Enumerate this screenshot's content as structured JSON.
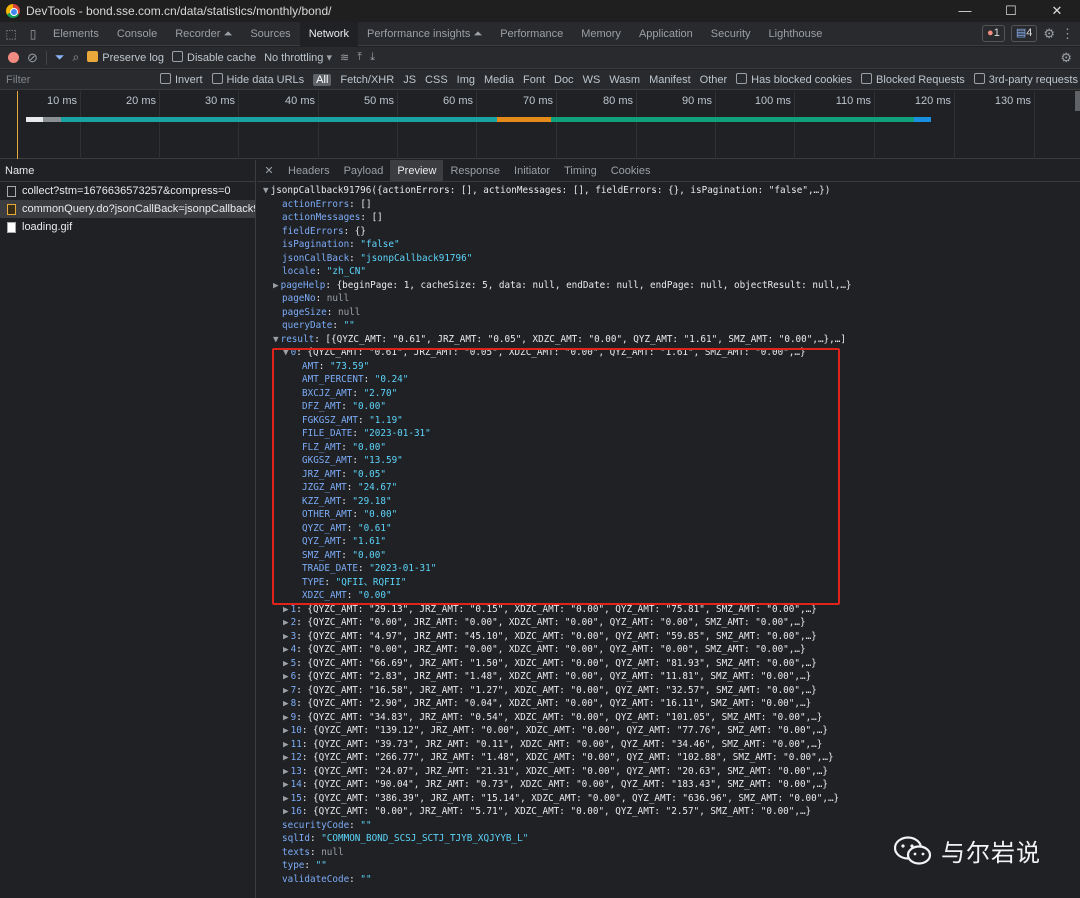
{
  "window": {
    "title": "DevTools - bond.sse.com.cn/data/statistics/monthly/bond/",
    "controls": [
      "—",
      "☐",
      "✕"
    ]
  },
  "devtools_tabs": [
    "Elements",
    "Console",
    "Recorder ⏶",
    "Sources",
    "Network",
    "Performance insights ⏶",
    "Performance",
    "Memory",
    "Application",
    "Security",
    "Lighthouse"
  ],
  "active_tab": "Network",
  "badges": {
    "errors": "1",
    "messages": "4"
  },
  "toolbar": {
    "preserve_log": "Preserve log",
    "disable_cache": "Disable cache",
    "throttling": "No throttling"
  },
  "filter": {
    "placeholder": "Filter",
    "invert": "Invert",
    "hide_data_urls": "Hide data URLs",
    "types": [
      "All",
      "Fetch/XHR",
      "JS",
      "CSS",
      "Img",
      "Media",
      "Font",
      "Doc",
      "WS",
      "Wasm",
      "Manifest",
      "Other"
    ],
    "blocked_cookies": "Has blocked cookies",
    "blocked_requests": "Blocked Requests",
    "third_party": "3rd-party requests"
  },
  "timeline_ticks": [
    "10 ms",
    "20 ms",
    "30 ms",
    "40 ms",
    "50 ms",
    "60 ms",
    "70 ms",
    "80 ms",
    "90 ms",
    "100 ms",
    "110 ms",
    "120 ms",
    "130 ms"
  ],
  "requests": {
    "header": "Name",
    "items": [
      {
        "name": "collect?stm=1676636573257&compress=0",
        "kind": "doc"
      },
      {
        "name": "commonQuery.do?jsonCallBack=jsonpCallback91…",
        "kind": "js"
      },
      {
        "name": "loading.gif",
        "kind": "img"
      }
    ]
  },
  "detail_tabs": [
    "Headers",
    "Payload",
    "Preview",
    "Response",
    "Initiator",
    "Timing",
    "Cookies"
  ],
  "active_detail_tab": "Preview",
  "preview_lines": [
    {
      "i": 0,
      "a": "▼",
      "t": [
        [
          "p",
          "jsonpCallback91796({actionErrors: [], actionMessages: [], fieldErrors: {}, isPagination: \"false\",…})"
        ]
      ]
    },
    {
      "i": 1,
      "t": [
        [
          "k",
          "actionErrors"
        ],
        [
          "p",
          ": []"
        ]
      ]
    },
    {
      "i": 1,
      "t": [
        [
          "k",
          "actionMessages"
        ],
        [
          "p",
          ": []"
        ]
      ]
    },
    {
      "i": 1,
      "t": [
        [
          "k",
          "fieldErrors"
        ],
        [
          "p",
          ": {}"
        ]
      ]
    },
    {
      "i": 1,
      "t": [
        [
          "k",
          "isPagination"
        ],
        [
          "p",
          ": "
        ],
        [
          "s",
          "\"false\""
        ]
      ]
    },
    {
      "i": 1,
      "t": [
        [
          "k",
          "jsonCallBack"
        ],
        [
          "p",
          ": "
        ],
        [
          "s",
          "\"jsonpCallback91796\""
        ]
      ]
    },
    {
      "i": 1,
      "t": [
        [
          "k",
          "locale"
        ],
        [
          "p",
          ": "
        ],
        [
          "s",
          "\"zh_CN\""
        ]
      ]
    },
    {
      "i": 1,
      "a": "▶",
      "t": [
        [
          "k",
          "pageHelp"
        ],
        [
          "p",
          ": {beginPage: 1, cacheSize: 5, data: null, endDate: null, endPage: null, objectResult: null,…}"
        ]
      ]
    },
    {
      "i": 1,
      "t": [
        [
          "k",
          "pageNo"
        ],
        [
          "p",
          ": "
        ],
        [
          "n",
          "null"
        ]
      ]
    },
    {
      "i": 1,
      "t": [
        [
          "k",
          "pageSize"
        ],
        [
          "p",
          ": "
        ],
        [
          "n",
          "null"
        ]
      ]
    },
    {
      "i": 1,
      "t": [
        [
          "k",
          "queryDate"
        ],
        [
          "p",
          ": "
        ],
        [
          "s",
          "\"\""
        ]
      ]
    },
    {
      "i": 1,
      "a": "▼",
      "t": [
        [
          "k",
          "result"
        ],
        [
          "p",
          ": [{QYZC_AMT: \"0.61\", JRZ_AMT: \"0.05\", XDZC_AMT: \"0.00\", QYZ_AMT: \"1.61\", SMZ_AMT: \"0.00\",…},…]"
        ]
      ]
    },
    {
      "i": 2,
      "a": "▼",
      "t": [
        [
          "k",
          "0"
        ],
        [
          "p",
          ": {QYZC_AMT: \"0.61\", JRZ_AMT: \"0.05\", XDZC_AMT: \"0.00\", QYZ_AMT: \"1.61\", SMZ_AMT: \"0.00\",…}"
        ]
      ]
    },
    {
      "i": 3,
      "t": [
        [
          "k",
          "AMT"
        ],
        [
          "p",
          ": "
        ],
        [
          "s",
          "\"73.59\""
        ]
      ]
    },
    {
      "i": 3,
      "t": [
        [
          "k",
          "AMT_PERCENT"
        ],
        [
          "p",
          ": "
        ],
        [
          "s",
          "\"0.24\""
        ]
      ]
    },
    {
      "i": 3,
      "t": [
        [
          "k",
          "BXCJZ_AMT"
        ],
        [
          "p",
          ": "
        ],
        [
          "s",
          "\"2.70\""
        ]
      ]
    },
    {
      "i": 3,
      "t": [
        [
          "k",
          "DFZ_AMT"
        ],
        [
          "p",
          ": "
        ],
        [
          "s",
          "\"0.00\""
        ]
      ]
    },
    {
      "i": 3,
      "t": [
        [
          "k",
          "FGKGSZ_AMT"
        ],
        [
          "p",
          ": "
        ],
        [
          "s",
          "\"1.19\""
        ]
      ]
    },
    {
      "i": 3,
      "t": [
        [
          "k",
          "FILE_DATE"
        ],
        [
          "p",
          ": "
        ],
        [
          "s",
          "\"2023-01-31\""
        ]
      ]
    },
    {
      "i": 3,
      "t": [
        [
          "k",
          "FLZ_AMT"
        ],
        [
          "p",
          ": "
        ],
        [
          "s",
          "\"0.00\""
        ]
      ]
    },
    {
      "i": 3,
      "t": [
        [
          "k",
          "GKGSZ_AMT"
        ],
        [
          "p",
          ": "
        ],
        [
          "s",
          "\"13.59\""
        ]
      ]
    },
    {
      "i": 3,
      "t": [
        [
          "k",
          "JRZ_AMT"
        ],
        [
          "p",
          ": "
        ],
        [
          "s",
          "\"0.05\""
        ]
      ]
    },
    {
      "i": 3,
      "t": [
        [
          "k",
          "JZGZ_AMT"
        ],
        [
          "p",
          ": "
        ],
        [
          "s",
          "\"24.67\""
        ]
      ]
    },
    {
      "i": 3,
      "t": [
        [
          "k",
          "KZZ_AMT"
        ],
        [
          "p",
          ": "
        ],
        [
          "s",
          "\"29.18\""
        ]
      ]
    },
    {
      "i": 3,
      "t": [
        [
          "k",
          "OTHER_AMT"
        ],
        [
          "p",
          ": "
        ],
        [
          "s",
          "\"0.00\""
        ]
      ]
    },
    {
      "i": 3,
      "t": [
        [
          "k",
          "QYZC_AMT"
        ],
        [
          "p",
          ": "
        ],
        [
          "s",
          "\"0.61\""
        ]
      ]
    },
    {
      "i": 3,
      "t": [
        [
          "k",
          "QYZ_AMT"
        ],
        [
          "p",
          ": "
        ],
        [
          "s",
          "\"1.61\""
        ]
      ]
    },
    {
      "i": 3,
      "t": [
        [
          "k",
          "SMZ_AMT"
        ],
        [
          "p",
          ": "
        ],
        [
          "s",
          "\"0.00\""
        ]
      ]
    },
    {
      "i": 3,
      "t": [
        [
          "k",
          "TRADE_DATE"
        ],
        [
          "p",
          ": "
        ],
        [
          "s",
          "\"2023-01-31\""
        ]
      ]
    },
    {
      "i": 3,
      "t": [
        [
          "k",
          "TYPE"
        ],
        [
          "p",
          ": "
        ],
        [
          "s",
          "\"QFII、RQFII\""
        ]
      ]
    },
    {
      "i": 3,
      "t": [
        [
          "k",
          "XDZC_AMT"
        ],
        [
          "p",
          ": "
        ],
        [
          "s",
          "\"0.00\""
        ]
      ]
    },
    {
      "i": 2,
      "a": "▶",
      "t": [
        [
          "k",
          "1"
        ],
        [
          "p",
          ": {QYZC_AMT: \"29.13\", JRZ_AMT: \"0.15\", XDZC_AMT: \"0.00\", QYZ_AMT: \"75.81\", SMZ_AMT: \"0.00\",…}"
        ]
      ]
    },
    {
      "i": 2,
      "a": "▶",
      "t": [
        [
          "k",
          "2"
        ],
        [
          "p",
          ": {QYZC_AMT: \"0.00\", JRZ_AMT: \"0.00\", XDZC_AMT: \"0.00\", QYZ_AMT: \"0.00\", SMZ_AMT: \"0.00\",…}"
        ]
      ]
    },
    {
      "i": 2,
      "a": "▶",
      "t": [
        [
          "k",
          "3"
        ],
        [
          "p",
          ": {QYZC_AMT: \"4.97\", JRZ_AMT: \"45.10\", XDZC_AMT: \"0.00\", QYZ_AMT: \"59.85\", SMZ_AMT: \"0.00\",…}"
        ]
      ]
    },
    {
      "i": 2,
      "a": "▶",
      "t": [
        [
          "k",
          "4"
        ],
        [
          "p",
          ": {QYZC_AMT: \"0.00\", JRZ_AMT: \"0.00\", XDZC_AMT: \"0.00\", QYZ_AMT: \"0.00\", SMZ_AMT: \"0.00\",…}"
        ]
      ]
    },
    {
      "i": 2,
      "a": "▶",
      "t": [
        [
          "k",
          "5"
        ],
        [
          "p",
          ": {QYZC_AMT: \"66.69\", JRZ_AMT: \"1.50\", XDZC_AMT: \"0.00\", QYZ_AMT: \"81.93\", SMZ_AMT: \"0.00\",…}"
        ]
      ]
    },
    {
      "i": 2,
      "a": "▶",
      "t": [
        [
          "k",
          "6"
        ],
        [
          "p",
          ": {QYZC_AMT: \"2.83\", JRZ_AMT: \"1.48\", XDZC_AMT: \"0.00\", QYZ_AMT: \"11.81\", SMZ_AMT: \"0.00\",…}"
        ]
      ]
    },
    {
      "i": 2,
      "a": "▶",
      "t": [
        [
          "k",
          "7"
        ],
        [
          "p",
          ": {QYZC_AMT: \"16.58\", JRZ_AMT: \"1.27\", XDZC_AMT: \"0.00\", QYZ_AMT: \"32.57\", SMZ_AMT: \"0.00\",…}"
        ]
      ]
    },
    {
      "i": 2,
      "a": "▶",
      "t": [
        [
          "k",
          "8"
        ],
        [
          "p",
          ": {QYZC_AMT: \"2.90\", JRZ_AMT: \"0.04\", XDZC_AMT: \"0.00\", QYZ_AMT: \"16.11\", SMZ_AMT: \"0.00\",…}"
        ]
      ]
    },
    {
      "i": 2,
      "a": "▶",
      "t": [
        [
          "k",
          "9"
        ],
        [
          "p",
          ": {QYZC_AMT: \"34.83\", JRZ_AMT: \"0.54\", XDZC_AMT: \"0.00\", QYZ_AMT: \"101.05\", SMZ_AMT: \"0.00\",…}"
        ]
      ]
    },
    {
      "i": 2,
      "a": "▶",
      "t": [
        [
          "k",
          "10"
        ],
        [
          "p",
          ": {QYZC_AMT: \"139.12\", JRZ_AMT: \"0.00\", XDZC_AMT: \"0.00\", QYZ_AMT: \"77.76\", SMZ_AMT: \"0.00\",…}"
        ]
      ]
    },
    {
      "i": 2,
      "a": "▶",
      "t": [
        [
          "k",
          "11"
        ],
        [
          "p",
          ": {QYZC_AMT: \"39.73\", JRZ_AMT: \"0.11\", XDZC_AMT: \"0.00\", QYZ_AMT: \"34.46\", SMZ_AMT: \"0.00\",…}"
        ]
      ]
    },
    {
      "i": 2,
      "a": "▶",
      "t": [
        [
          "k",
          "12"
        ],
        [
          "p",
          ": {QYZC_AMT: \"266.77\", JRZ_AMT: \"1.48\", XDZC_AMT: \"0.00\", QYZ_AMT: \"102.88\", SMZ_AMT: \"0.00\",…}"
        ]
      ]
    },
    {
      "i": 2,
      "a": "▶",
      "t": [
        [
          "k",
          "13"
        ],
        [
          "p",
          ": {QYZC_AMT: \"24.07\", JRZ_AMT: \"21.31\", XDZC_AMT: \"0.00\", QYZ_AMT: \"20.63\", SMZ_AMT: \"0.00\",…}"
        ]
      ]
    },
    {
      "i": 2,
      "a": "▶",
      "t": [
        [
          "k",
          "14"
        ],
        [
          "p",
          ": {QYZC_AMT: \"90.04\", JRZ_AMT: \"0.73\", XDZC_AMT: \"0.00\", QYZ_AMT: \"183.43\", SMZ_AMT: \"0.00\",…}"
        ]
      ]
    },
    {
      "i": 2,
      "a": "▶",
      "t": [
        [
          "k",
          "15"
        ],
        [
          "p",
          ": {QYZC_AMT: \"386.39\", JRZ_AMT: \"15.14\", XDZC_AMT: \"0.00\", QYZ_AMT: \"636.96\", SMZ_AMT: \"0.00\",…}"
        ]
      ]
    },
    {
      "i": 2,
      "a": "▶",
      "t": [
        [
          "k",
          "16"
        ],
        [
          "p",
          ": {QYZC_AMT: \"0.00\", JRZ_AMT: \"5.71\", XDZC_AMT: \"0.00\", QYZ_AMT: \"2.57\", SMZ_AMT: \"0.00\",…}"
        ]
      ]
    },
    {
      "i": 1,
      "t": [
        [
          "k",
          "securityCode"
        ],
        [
          "p",
          ": "
        ],
        [
          "s",
          "\"\""
        ]
      ]
    },
    {
      "i": 1,
      "t": [
        [
          "k",
          "sqlId"
        ],
        [
          "p",
          ": "
        ],
        [
          "s",
          "\"COMMON_BOND_SCSJ_SCTJ_TJYB_XQJYYB_L\""
        ]
      ]
    },
    {
      "i": 1,
      "t": [
        [
          "k",
          "texts"
        ],
        [
          "p",
          ": "
        ],
        [
          "n",
          "null"
        ]
      ]
    },
    {
      "i": 1,
      "t": [
        [
          "k",
          "type"
        ],
        [
          "p",
          ": "
        ],
        [
          "s",
          "\"\""
        ]
      ]
    },
    {
      "i": 1,
      "t": [
        [
          "k",
          "validateCode"
        ],
        [
          "p",
          ": "
        ],
        [
          "s",
          "\"\""
        ]
      ]
    }
  ],
  "watermark": {
    "text": "与尔岩说"
  }
}
